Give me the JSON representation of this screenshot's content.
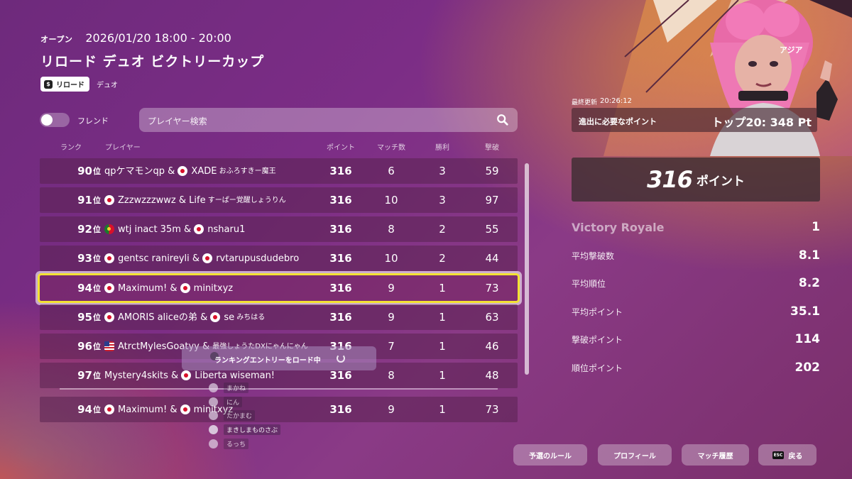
{
  "header": {
    "status": "オープン",
    "datetime": "2026/01/20 18:00 - 20:00",
    "title": "リロード デュオ ビクトリーカップ",
    "mode_tag": "リロード",
    "team_tag": "デュオ"
  },
  "filters": {
    "friends_label": "フレンド",
    "search_placeholder": "プレイヤー検索"
  },
  "columns": {
    "rank": "ランク",
    "player": "プレイヤー",
    "points": "ポイント",
    "matches": "マッチ数",
    "wins": "勝利",
    "kills": "撃破"
  },
  "rank_unit": "位",
  "rows": [
    {
      "rank": "90",
      "p1": "qpケマモンqp",
      "sep": " & ",
      "p2": "XADE",
      "p2_suffix": " おふろすきー魔王",
      "points": "316",
      "matches": "6",
      "wins": "3",
      "kills": "59"
    },
    {
      "rank": "91",
      "p1": "Zzzwzzzwwz",
      "sep": " & ",
      "p2": "Life",
      "p2_suffix": " すーぱー覚醒しょうりん",
      "points": "316",
      "matches": "10",
      "wins": "3",
      "kills": "97"
    },
    {
      "rank": "92",
      "p1": "wtj inact 35m",
      "sep": " & ",
      "p2": "nsharu1",
      "p2_suffix": "",
      "points": "316",
      "matches": "8",
      "wins": "2",
      "kills": "55"
    },
    {
      "rank": "93",
      "p1": "gentsc ranireyli",
      "sep": " & ",
      "p2": "rvtarupusdudebro",
      "p2_suffix": "",
      "points": "316",
      "matches": "10",
      "wins": "2",
      "kills": "44"
    },
    {
      "rank": "94",
      "p1": "Maximum!",
      "sep": " & ",
      "p2": "minitxyz",
      "p2_suffix": "",
      "points": "316",
      "matches": "9",
      "wins": "1",
      "kills": "73"
    },
    {
      "rank": "95",
      "p1": "AMORIS aliceの弟",
      "sep": " & ",
      "p2": "se",
      "p2_suffix": " みちはる",
      "points": "316",
      "matches": "9",
      "wins": "1",
      "kills": "63"
    },
    {
      "rank": "96",
      "p1": "AtrctMylesGoatyy",
      "sep": " & ",
      "p2": "最強しょうたDXにゃんにゃん",
      "p2_suffix": "",
      "points": "316",
      "matches": "7",
      "wins": "1",
      "kills": "46"
    },
    {
      "rank": "97",
      "p1": "Mystery4skits",
      "sep": " & ",
      "p2": "Liberta wiseman!",
      "p2_suffix": "",
      "points": "316",
      "matches": "8",
      "wins": "1",
      "kills": "48"
    }
  ],
  "my_row": {
    "rank": "94",
    "p1": "Maximum!",
    "sep": " & ",
    "p2": "minitxyz",
    "points": "316",
    "matches": "9",
    "wins": "1",
    "kills": "73"
  },
  "loading_text": "ランキングエントリーをロード中",
  "friends_overlay": [
    "まかね",
    "にん",
    "たかまむ",
    "まきしまものさぶ",
    "るっち"
  ],
  "panel": {
    "region": "アジア",
    "last_updated_label": "最終更新",
    "last_updated_value": "20:26:12",
    "required_label": "進出に必要なポイント",
    "required_value": "トップ20: 348 Pt",
    "score_value": "316",
    "score_unit": "ポイント",
    "stats": [
      {
        "label": "Victory Royale",
        "value": "1"
      },
      {
        "label": "平均撃破数",
        "value": "8.1"
      },
      {
        "label": "平均順位",
        "value": "8.2"
      },
      {
        "label": "平均ポイント",
        "value": "35.1"
      },
      {
        "label": "撃破ポイント",
        "value": "114"
      },
      {
        "label": "順位ポイント",
        "value": "202"
      }
    ]
  },
  "buttons": {
    "rules": "予選のルール",
    "profile": "プロフィール",
    "history": "マッチ履歴",
    "back_key": "ESC",
    "back": "戻る"
  },
  "colors": {
    "highlight": "#f3e233",
    "bg_purple": "#7c2d86",
    "bg_orange": "#e89628"
  }
}
